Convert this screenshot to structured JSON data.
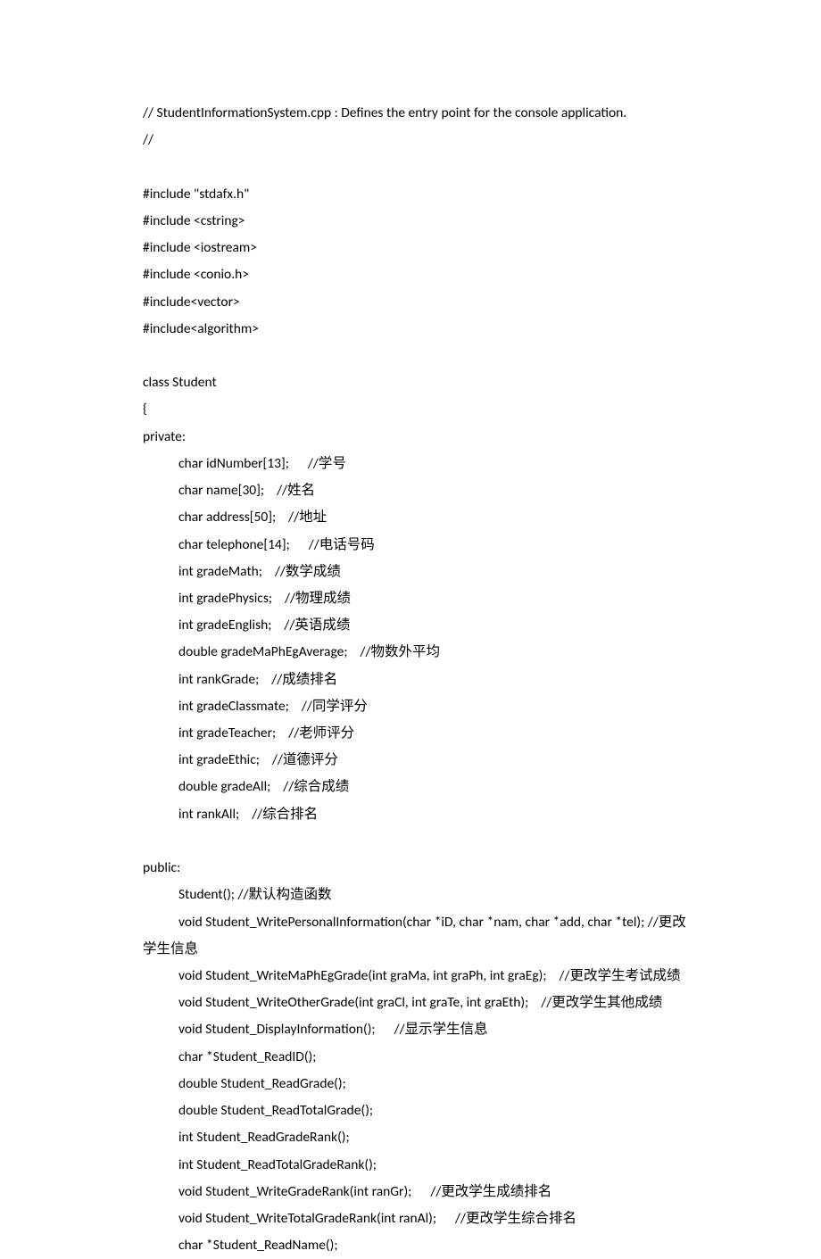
{
  "lines": [
    {
      "text": "// StudentInformationSystem.cpp : Defines the entry point for the console application.",
      "blank": false,
      "indent": 0
    },
    {
      "text": "//",
      "blank": false,
      "indent": 0
    },
    {
      "text": "",
      "blank": true,
      "indent": 0
    },
    {
      "text": "#include \"stdafx.h\"",
      "blank": false,
      "indent": 0
    },
    {
      "text": "#include <cstring>",
      "blank": false,
      "indent": 0
    },
    {
      "text": "#include <iostream>",
      "blank": false,
      "indent": 0
    },
    {
      "text": "#include <conio.h>",
      "blank": false,
      "indent": 0
    },
    {
      "text": "#include<vector>",
      "blank": false,
      "indent": 0
    },
    {
      "text": "#include<algorithm>",
      "blank": false,
      "indent": 0
    },
    {
      "text": "",
      "blank": true,
      "indent": 0
    },
    {
      "text": "class Student",
      "blank": false,
      "indent": 0
    },
    {
      "text": "{",
      "blank": false,
      "indent": 0
    },
    {
      "text": "private:",
      "blank": false,
      "indent": 0
    },
    {
      "text": "char idNumber[13];      //学号",
      "blank": false,
      "indent": 1
    },
    {
      "text": "char name[30];    //姓名",
      "blank": false,
      "indent": 1
    },
    {
      "text": "char address[50];    //地址",
      "blank": false,
      "indent": 1
    },
    {
      "text": "char telephone[14];      //电话号码",
      "blank": false,
      "indent": 1
    },
    {
      "text": "int gradeMath;    //数学成绩",
      "blank": false,
      "indent": 1
    },
    {
      "text": "int gradePhysics;    //物理成绩",
      "blank": false,
      "indent": 1
    },
    {
      "text": "int gradeEnglish;    //英语成绩",
      "blank": false,
      "indent": 1
    },
    {
      "text": "double gradeMaPhEgAverage;    //物数外平均",
      "blank": false,
      "indent": 1
    },
    {
      "text": "int rankGrade;    //成绩排名",
      "blank": false,
      "indent": 1
    },
    {
      "text": "int gradeClassmate;    //同学评分",
      "blank": false,
      "indent": 1
    },
    {
      "text": "int gradeTeacher;    //老师评分",
      "blank": false,
      "indent": 1
    },
    {
      "text": "int gradeEthic;    //道德评分",
      "blank": false,
      "indent": 1
    },
    {
      "text": "double gradeAll;    //综合成绩",
      "blank": false,
      "indent": 1
    },
    {
      "text": "int rankAll;    //综合排名",
      "blank": false,
      "indent": 1
    },
    {
      "text": "",
      "blank": true,
      "indent": 0
    },
    {
      "text": "public:",
      "blank": false,
      "indent": 0
    },
    {
      "text": "Student(); //默认构造函数",
      "blank": false,
      "indent": 1
    },
    {
      "text": "void Student_WritePersonalInformation(char *iD, char *nam, char *add, char *tel); //更改",
      "blank": false,
      "indent": 1
    },
    {
      "text": "学生信息",
      "blank": false,
      "indent": 0
    },
    {
      "text": "void Student_WriteMaPhEgGrade(int graMa, int graPh, int graEg);    //更改学生考试成绩",
      "blank": false,
      "indent": 1
    },
    {
      "text": "void Student_WriteOtherGrade(int graCl, int graTe, int graEth);    //更改学生其他成绩",
      "blank": false,
      "indent": 1
    },
    {
      "text": "void Student_DisplayInformation();      //显示学生信息",
      "blank": false,
      "indent": 1
    },
    {
      "text": "char *Student_ReadID();",
      "blank": false,
      "indent": 1
    },
    {
      "text": "double Student_ReadGrade();",
      "blank": false,
      "indent": 1
    },
    {
      "text": "double Student_ReadTotalGrade();",
      "blank": false,
      "indent": 1
    },
    {
      "text": "int Student_ReadGradeRank();",
      "blank": false,
      "indent": 1
    },
    {
      "text": "int Student_ReadTotalGradeRank();",
      "blank": false,
      "indent": 1
    },
    {
      "text": "void Student_WriteGradeRank(int ranGr);      //更改学生成绩排名",
      "blank": false,
      "indent": 1
    },
    {
      "text": "void Student_WriteTotalGradeRank(int ranAl);      //更改学生综合排名",
      "blank": false,
      "indent": 1
    },
    {
      "text": "char *Student_ReadName();",
      "blank": false,
      "indent": 1
    }
  ]
}
